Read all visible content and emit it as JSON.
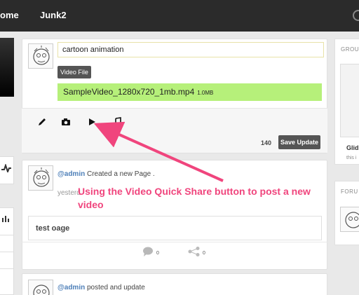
{
  "topbar": {
    "home_label": "ome",
    "junk_label": "Junk2"
  },
  "composer": {
    "text_value": "cartoon animation",
    "file_badge": "Video File",
    "file_name": "SampleVideo_1280x720_1mb.mp4",
    "file_size": "1.0MB",
    "char_count": "140",
    "save_label": "Save Update"
  },
  "feed": [
    {
      "author": "@admin",
      "action": " Created a new Page .",
      "time": "yesterd",
      "post_title": "test oage",
      "comments": "0",
      "shares": "0"
    },
    {
      "author": "@admin",
      "action": " posted and update"
    }
  ],
  "annotation": "Using the Video Quick Share button to post a new video",
  "right": {
    "group_heading": "GROU",
    "group_title": "Glid",
    "group_sub": "this i",
    "forum_heading": "FORU"
  },
  "colors": {
    "accent_green": "#b6f07a",
    "annotation_pink": "#f0457d",
    "link_blue": "#4d7fb8",
    "topbar": "#2b2b2b"
  }
}
